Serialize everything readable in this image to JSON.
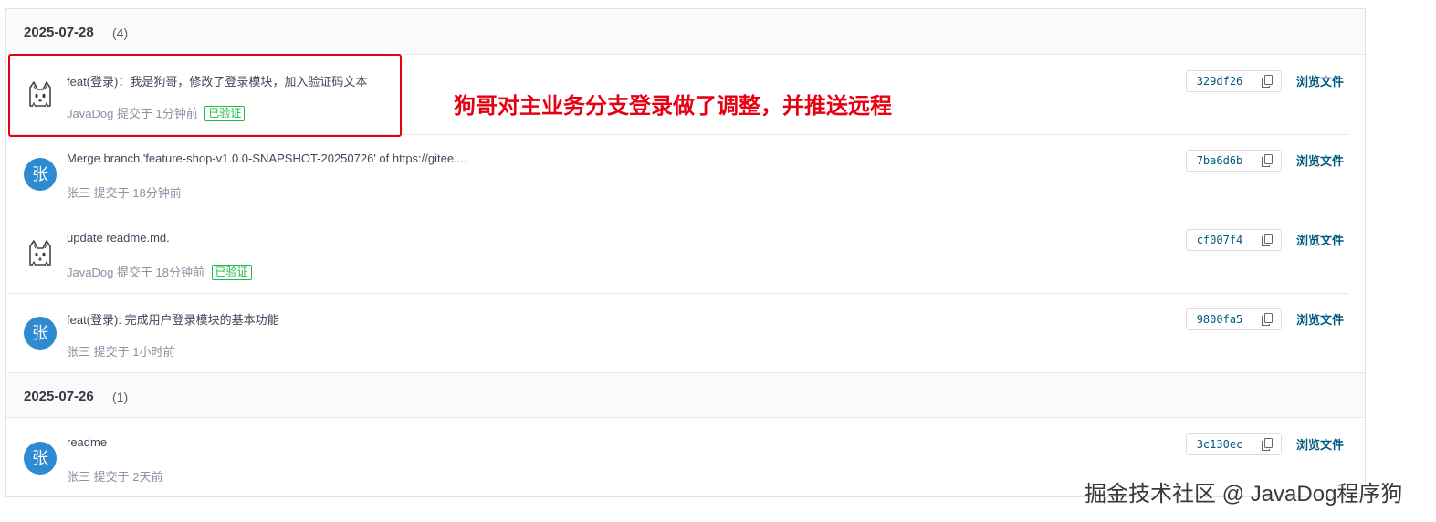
{
  "groups": [
    {
      "date": "2025-07-28",
      "count": "(4)",
      "commits": [
        {
          "avatar_type": "dog",
          "avatar_text": "",
          "message": "feat(登录)：我是狗哥，修改了登录模块，加入验证码文本",
          "author": "JavaDog",
          "time": "提交于 1分钟前",
          "verified": "已验证",
          "sha": "329df26",
          "browse": "浏览文件"
        },
        {
          "avatar_type": "letter",
          "avatar_text": "张",
          "message": "Merge branch 'feature-shop-v1.0.0-SNAPSHOT-20250726' of https://gitee....",
          "author": "张三",
          "time": "提交于 18分钟前",
          "verified": "",
          "sha": "7ba6d6b",
          "browse": "浏览文件"
        },
        {
          "avatar_type": "dog",
          "avatar_text": "",
          "message": "update readme.md.",
          "author": "JavaDog",
          "time": "提交于 18分钟前",
          "verified": "已验证",
          "sha": "cf007f4",
          "browse": "浏览文件"
        },
        {
          "avatar_type": "letter",
          "avatar_text": "张",
          "message": "feat(登录): 完成用户登录模块的基本功能",
          "author": "张三",
          "time": "提交于 1小时前",
          "verified": "",
          "sha": "9800fa5",
          "browse": "浏览文件"
        }
      ]
    },
    {
      "date": "2025-07-26",
      "count": "(1)",
      "commits": [
        {
          "avatar_type": "letter",
          "avatar_text": "张",
          "message": "readme",
          "author": "张三",
          "time": "提交于 2天前",
          "verified": "",
          "sha": "3c130ec",
          "browse": "浏览文件"
        }
      ]
    }
  ],
  "annotation": "狗哥对主业务分支登录做了调整，并推送远程",
  "watermark": "掘金技术社区 @ JavaDog程序狗",
  "colors": {
    "accent": "#005980",
    "avatar_bg": "#2e8bcf",
    "verified": "#21ba45",
    "annotation": "#e60012"
  },
  "icons": {
    "copy": "copy-icon",
    "dog_avatar": "dog-avatar-icon"
  }
}
